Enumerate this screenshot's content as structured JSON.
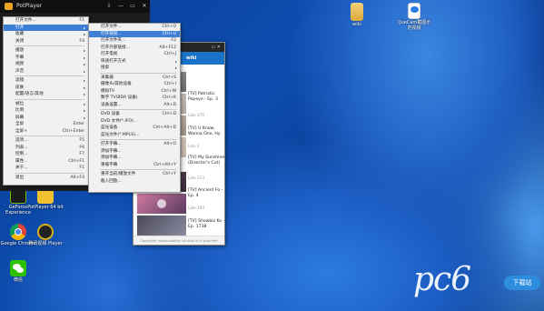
{
  "app": {
    "title": "PotPlayer"
  },
  "window_controls": {
    "pin": "⇩",
    "minimize": "—",
    "maximize": "▭",
    "close": "✕"
  },
  "main_menu": [
    {
      "label": "打开文件...",
      "shortcut": "F1"
    },
    {
      "label": "打开",
      "shortcut": "",
      "submenu": true,
      "highlighted": true
    },
    {
      "label": "收藏",
      "shortcut": "",
      "submenu": true
    },
    {
      "label": "关闭",
      "shortcut": "F4"
    },
    {
      "sep": true
    },
    {
      "label": "播放",
      "shortcut": "",
      "submenu": true
    },
    {
      "label": "字幕",
      "shortcut": "",
      "submenu": true
    },
    {
      "label": "视频",
      "shortcut": "",
      "submenu": true
    },
    {
      "label": "声音",
      "shortcut": "",
      "submenu": true
    },
    {
      "sep": true
    },
    {
      "label": "滤镜",
      "shortcut": "",
      "submenu": true
    },
    {
      "label": "皮肤",
      "shortcut": "",
      "submenu": true
    },
    {
      "label": "配置/语言/其他",
      "shortcut": "",
      "submenu": true
    },
    {
      "sep": true
    },
    {
      "label": "帧位",
      "shortcut": "",
      "submenu": true
    },
    {
      "label": "比例",
      "shortcut": "",
      "submenu": true
    },
    {
      "label": "屏幕",
      "shortcut": "",
      "submenu": true
    },
    {
      "label": "全屏",
      "shortcut": "Enter"
    },
    {
      "label": "全屏+",
      "shortcut": "Ctrl+Enter"
    },
    {
      "sep": true
    },
    {
      "label": "选项...",
      "shortcut": "F5"
    },
    {
      "label": "列表...",
      "shortcut": "F6"
    },
    {
      "label": "控制...",
      "shortcut": "F7"
    },
    {
      "label": "属性...",
      "shortcut": "Ctrl+F1"
    },
    {
      "label": "关于...",
      "shortcut": "F1"
    },
    {
      "sep": true
    },
    {
      "label": "退出",
      "shortcut": "Alt+F4"
    }
  ],
  "open_submenu": [
    {
      "label": "打开文件...",
      "shortcut": "Ctrl+O"
    },
    {
      "label": "打开链接...",
      "shortcut": "Ctrl+U",
      "highlighted": true
    },
    {
      "label": "打开文件夹...",
      "shortcut": "F2"
    },
    {
      "label": "打开外部链接...",
      "shortcut": "Alt+F12"
    },
    {
      "label": "打开电视",
      "shortcut": "Ctrl+J"
    },
    {
      "label": "快速打开方式",
      "shortcut": "",
      "submenu": true
    },
    {
      "label": "搜索",
      "shortcut": "",
      "submenu": true
    },
    {
      "sep": true
    },
    {
      "label": "采集器",
      "shortcut": "Ctrl+S"
    },
    {
      "label": "摄像头/其他设备",
      "shortcut": "Ctrl+I"
    },
    {
      "label": "模拟TV",
      "shortcut": "Ctrl+W"
    },
    {
      "label": "数字 TV(BDA 设备)",
      "shortcut": "Ctrl+K"
    },
    {
      "label": "设备设置...",
      "shortcut": "Alt+D"
    },
    {
      "sep": true
    },
    {
      "label": "DVD 设备",
      "shortcut": "Ctrl+D"
    },
    {
      "label": "DVD 文件(*.IFO)...",
      "shortcut": ""
    },
    {
      "label": "蓝光设备",
      "shortcut": "Ctrl+Alt+D"
    },
    {
      "label": "蓝光文件(*.MPLS)...",
      "shortcut": ""
    },
    {
      "sep": true
    },
    {
      "label": "打开字幕...",
      "shortcut": "Alt+O"
    },
    {
      "label": "添加字幕...",
      "shortcut": ""
    },
    {
      "label": "添加字幕...",
      "shortcut": ""
    },
    {
      "label": "重载字幕",
      "shortcut": "Ctrl+Alt+Y"
    },
    {
      "sep": true
    },
    {
      "label": "重开当前/播放文件",
      "shortcut": "Ctrl+Y"
    },
    {
      "label": "截入回放...",
      "shortcut": ""
    }
  ],
  "browser": {
    "title_controls": "▭ ✕",
    "header": "wiki",
    "items": [
      {
        "title": "[TV] Patriotic Popeye - Ep. 3",
        "likes": "Like 379"
      },
      {
        "title": "[TV] U Know, Wanna One, Hy",
        "likes": "Like 2"
      },
      {
        "title": "[TV] My Sunshine (Director's Cut)",
        "likes": "Like 313"
      },
      {
        "title": "[TV] Ancient Fo - Ep. 4",
        "likes": "Like 193"
      },
      {
        "title": "[TV] Showbiz Ko - Ep. 1738",
        "likes": ""
      }
    ],
    "footer": "Copyright responsibility of clips is in provider"
  },
  "desktop_icons": [
    {
      "label": "wiki",
      "icon": "folder-icon"
    },
    {
      "label": "QueCam截图示范视频",
      "icon": "pdf-icon"
    },
    {
      "label": "GeForce Experience",
      "icon": "nvidia-icon"
    },
    {
      "label": "PotPlayer 64 bit",
      "icon": "potplayer-icon"
    },
    {
      "label": "Google Chrome",
      "icon": "chrome-icon"
    },
    {
      "label": "腾讯视频 Player",
      "icon": "player-icon"
    },
    {
      "label": "微信",
      "icon": "wechat-icon"
    }
  ],
  "watermark": {
    "text": "pc6",
    "badge": "下载站"
  }
}
